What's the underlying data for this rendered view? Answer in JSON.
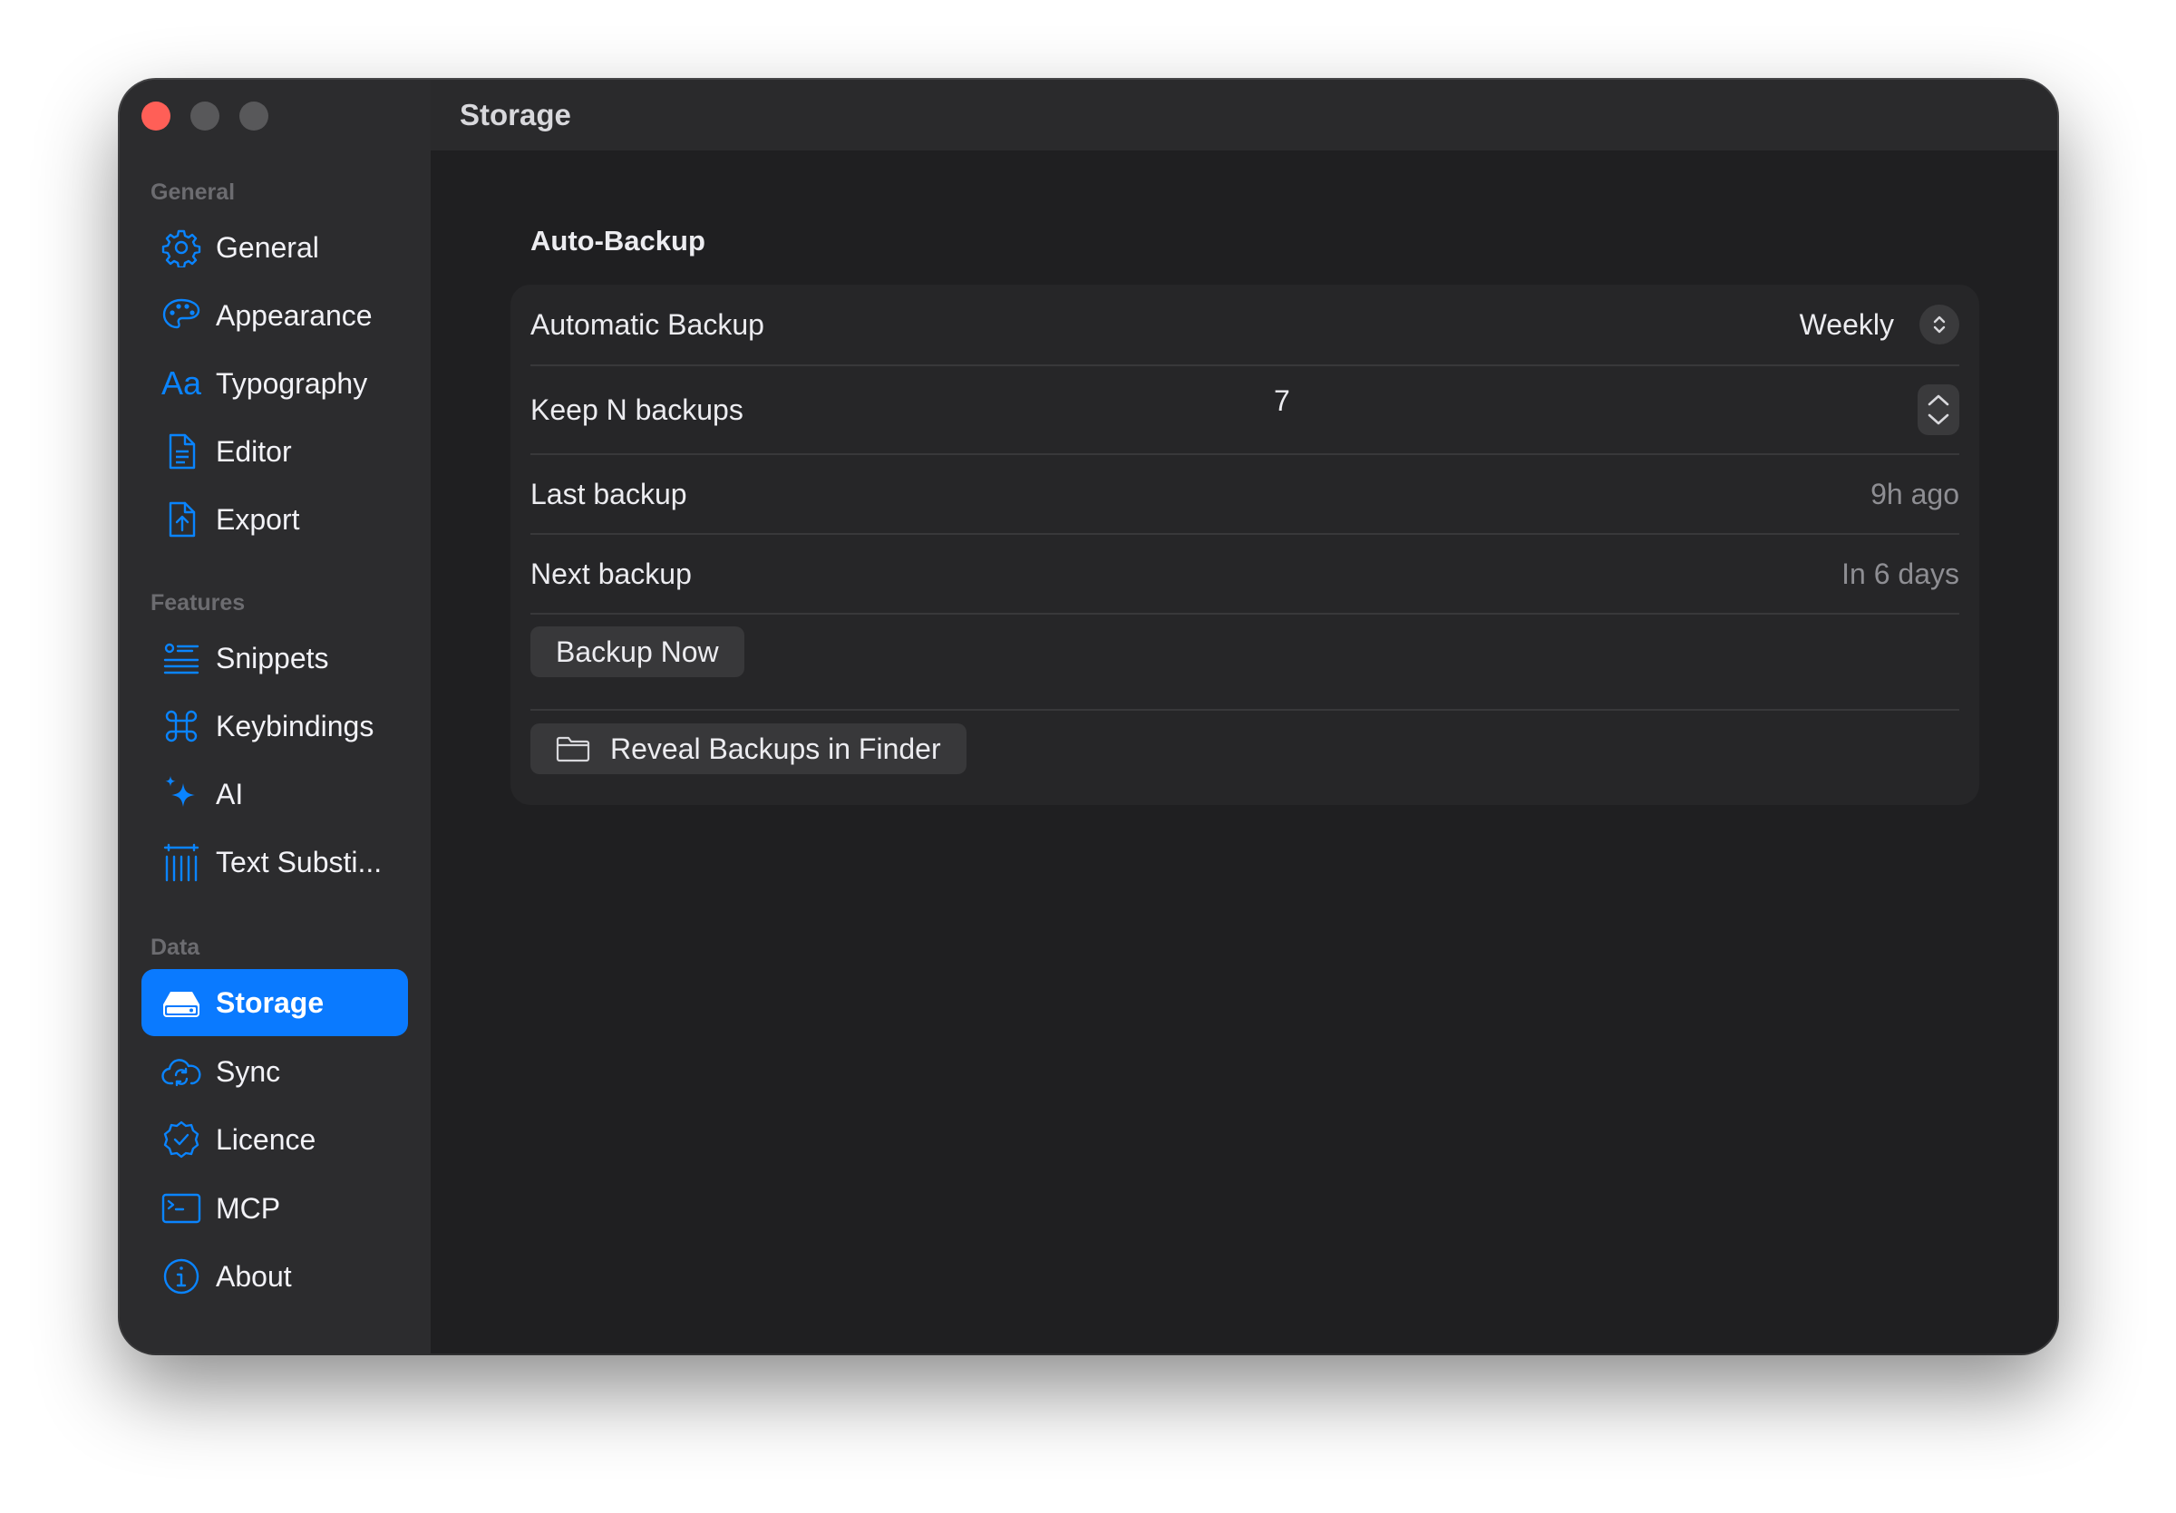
{
  "window": {
    "title": "Storage"
  },
  "sidebar": {
    "sections": [
      {
        "label": "General",
        "items": [
          {
            "label": "General",
            "icon": "gear-icon"
          },
          {
            "label": "Appearance",
            "icon": "palette-icon"
          },
          {
            "label": "Typography",
            "icon": "typography-icon",
            "glyph": "Aa"
          },
          {
            "label": "Editor",
            "icon": "document-icon"
          },
          {
            "label": "Export",
            "icon": "export-icon"
          }
        ]
      },
      {
        "label": "Features",
        "items": [
          {
            "label": "Snippets",
            "icon": "snippets-icon"
          },
          {
            "label": "Keybindings",
            "icon": "command-icon"
          },
          {
            "label": "AI",
            "icon": "sparkle-icon"
          },
          {
            "label": "Text Substi...",
            "icon": "text-substitution-icon"
          }
        ]
      },
      {
        "label": "Data",
        "items": [
          {
            "label": "Storage",
            "icon": "drive-icon",
            "active": true
          },
          {
            "label": "Sync",
            "icon": "cloud-sync-icon"
          },
          {
            "label": "Licence",
            "icon": "checkmark-seal-icon"
          },
          {
            "label": "MCP",
            "icon": "terminal-icon"
          },
          {
            "label": "About",
            "icon": "info-icon"
          }
        ]
      }
    ]
  },
  "main": {
    "group_title": "Auto-Backup",
    "automatic_backup": {
      "label": "Automatic Backup",
      "value": "Weekly"
    },
    "keep_backups": {
      "label": "Keep N backups",
      "value": "7"
    },
    "last_backup": {
      "label": "Last backup",
      "value": "9h ago"
    },
    "next_backup": {
      "label": "Next backup",
      "value": "In 6 days"
    },
    "backup_now_label": "Backup Now",
    "reveal_label": "Reveal Backups in Finder"
  },
  "colors": {
    "accent": "#0a7aff",
    "window_bg": "#1f1f21",
    "sidebar_bg": "#2c2c2e",
    "card_bg": "#262628",
    "close_button": "#ff5f57"
  }
}
